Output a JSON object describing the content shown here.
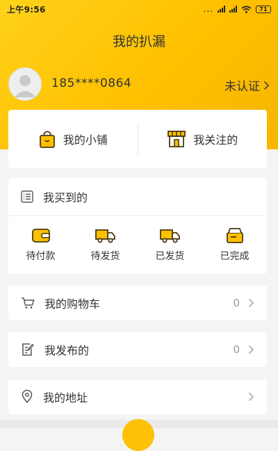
{
  "status_bar": {
    "time": "上午9:56",
    "dots": "...",
    "battery": "71"
  },
  "header": {
    "title": "我的扒漏"
  },
  "profile": {
    "phone": "185****0864",
    "verify_label": "未认证"
  },
  "shop_links": [
    {
      "label": "我的小铺",
      "icon": "shopping-bag-icon"
    },
    {
      "label": "我关注的",
      "icon": "storefront-icon"
    }
  ],
  "orders": {
    "title": "我买到的",
    "items": [
      {
        "label": "待付款",
        "icon": "wallet-icon"
      },
      {
        "label": "待发货",
        "icon": "truck-icon"
      },
      {
        "label": "已发货",
        "icon": "truck-icon"
      },
      {
        "label": "已完成",
        "icon": "box-icon"
      }
    ]
  },
  "menu": [
    {
      "label": "我的购物车",
      "count": "0",
      "icon": "cart-icon"
    },
    {
      "label": "我发布的",
      "count": "0",
      "icon": "edit-doc-icon"
    },
    {
      "label": "我的地址",
      "count": "",
      "icon": "location-pin-icon"
    }
  ],
  "colors": {
    "accent": "#ffc000",
    "icon_dark": "#4a3a10",
    "text": "#333333",
    "muted": "#999999"
  }
}
